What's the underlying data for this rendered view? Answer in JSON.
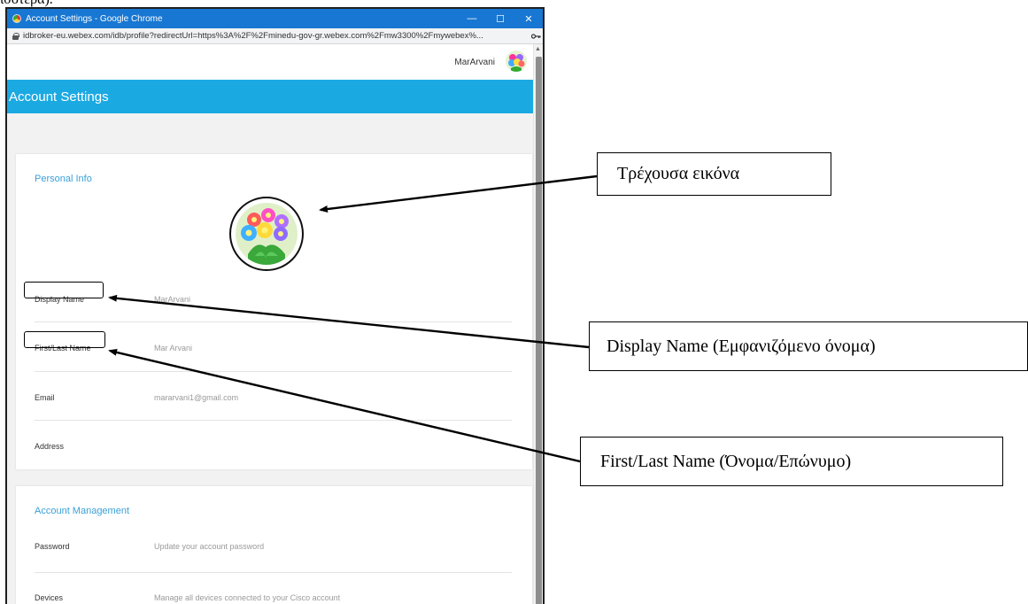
{
  "doc_fragment": "ισότερα).",
  "window": {
    "title": "Account Settings - Google Chrome",
    "minimize_glyph": "—",
    "maximize_glyph": "☐",
    "close_glyph": "✕",
    "url": "idbroker-eu.webex.com/idb/profile?redirectUrl=https%3A%2F%2Fminedu-gov-gr.webex.com%2Fmw3300%2Fmywebex%...",
    "key_icon": "key-icon",
    "lock_icon": "lock-icon"
  },
  "topnav": {
    "user_name": "MarArvani"
  },
  "header": {
    "title": "Account Settings",
    "color": "#1ba9e2"
  },
  "personal_info": {
    "section_title": "Personal Info",
    "fields": [
      {
        "label": "Display Name",
        "value": "MarArvani"
      },
      {
        "label": "First/Last Name",
        "value": "Mar Arvani"
      },
      {
        "label": "Email",
        "value": "mararvani1@gmail.com"
      },
      {
        "label": "Address",
        "value": ""
      }
    ]
  },
  "account_management": {
    "section_title": "Account Management",
    "fields": [
      {
        "label": "Password",
        "value": "Update your account password"
      },
      {
        "label": "Devices",
        "value": "Manage all devices connected to your Cisco account"
      }
    ]
  },
  "annotations": {
    "current_image": "Τρέχουσα εικόνα",
    "display_name": "Display Name (Εμφανιζόμενο όνομα)",
    "first_last_name": "First/Last Name (Όνομα/Επώνυμο)"
  }
}
